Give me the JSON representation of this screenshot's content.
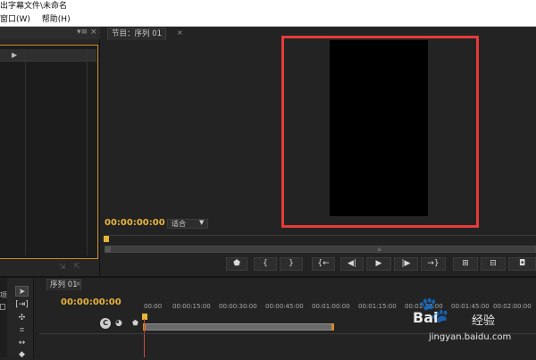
{
  "window": {
    "title": "出字幕文件\\未命名"
  },
  "menu": {
    "items": [
      "窗口(W)",
      "帮助(H)"
    ]
  },
  "left_panel": {},
  "program_monitor": {
    "tab_label": "节目：序列 01",
    "timecode": "00:00:00:00",
    "fit_label": "适合"
  },
  "controls": {
    "buttons": [
      "marker-icon",
      "in-point-icon",
      "out-point-icon",
      "go-to-in-icon",
      "step-back-icon",
      "play-icon",
      "step-forward-icon",
      "go-to-out-icon",
      "lift-icon",
      "extract-icon",
      "export-frame-icon"
    ]
  },
  "timeline": {
    "tab_label": "序列 01",
    "timecode": "00:00:00:00",
    "ruler_ticks": [
      "00:00",
      "00:00:15:00",
      "00:00:30:00",
      "00:00:45:00",
      "00:01:00:00",
      "00:01:15:00",
      "00:01:30:00",
      "00:01:45:00",
      "00:02:00:00"
    ]
  },
  "tools": {
    "side_label": "项"
  },
  "watermark": {
    "brand": "Bai",
    "brand2": "经验",
    "url": "jingyan.baidu.com"
  }
}
